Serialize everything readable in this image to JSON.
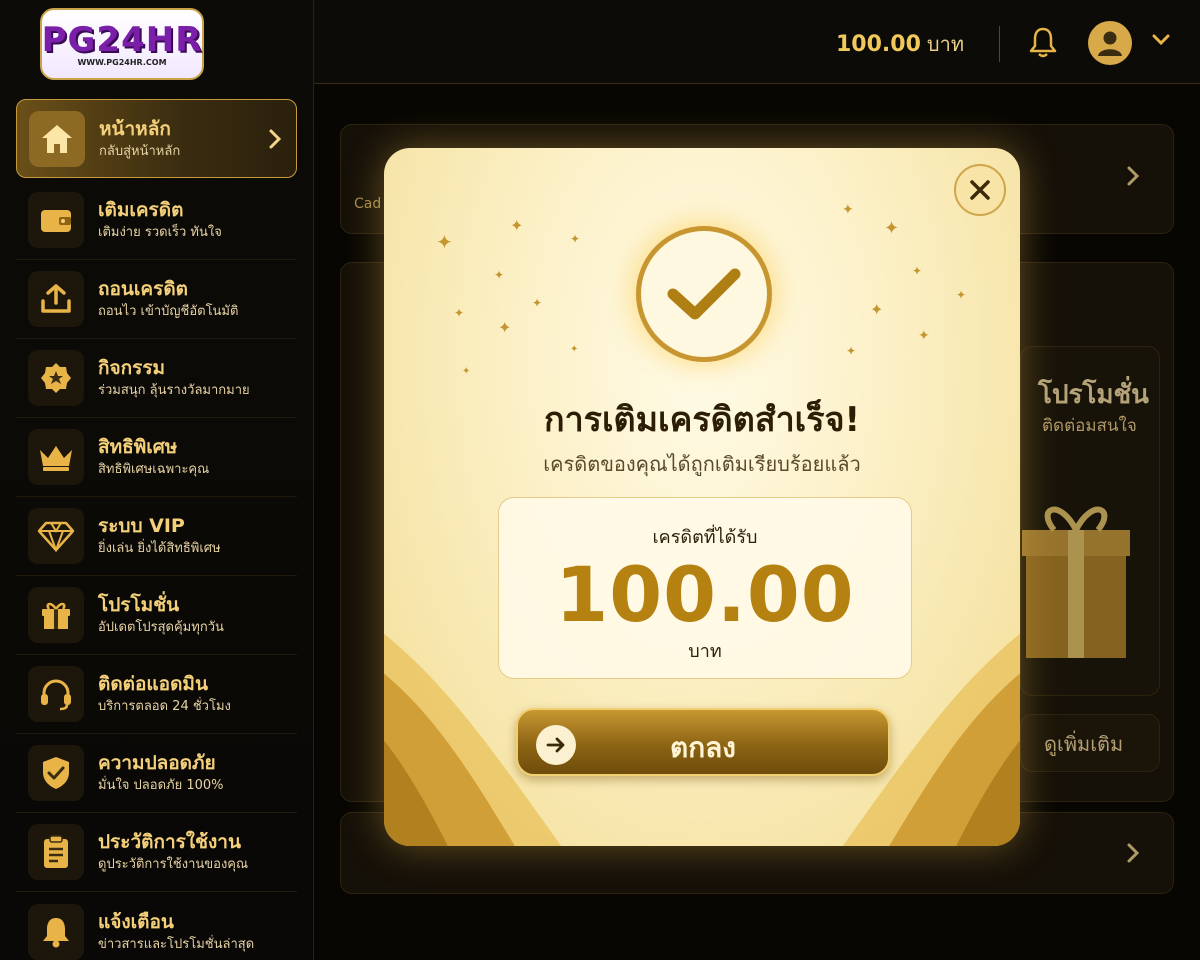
{
  "brand": {
    "logo_text": "PG24HR",
    "logo_url": "WWW.PG24HR.COM"
  },
  "header": {
    "balance_amount": "100.00",
    "balance_unit": "บาท",
    "bell_icon": "bell-icon",
    "avatar_icon": "user-icon"
  },
  "sidebar": {
    "items": [
      {
        "title": "หน้าหลัก",
        "sub": "กลับสู่หน้าหลัก",
        "icon": "home-icon",
        "active": true
      },
      {
        "title": "เติมเครดิต",
        "sub": "เติมง่าย รวดเร็ว ทันใจ",
        "icon": "wallet-icon"
      },
      {
        "title": "ถอนเครดิต",
        "sub": "ถอนไว เข้าบัญชีอัตโนมัติ",
        "icon": "upload-icon"
      },
      {
        "title": "กิจกรรม",
        "sub": "ร่วมสนุก ลุ้นรางวัลมากมาย",
        "icon": "star-badge-icon"
      },
      {
        "title": "สิทธิพิเศษ",
        "sub": "สิทธิพิเศษเฉพาะคุณ",
        "icon": "crown-icon"
      },
      {
        "title": "ระบบ VIP",
        "sub": "ยิ่งเล่น ยิ่งได้สิทธิพิเศษ",
        "icon": "diamond-icon"
      },
      {
        "title": "โปรโมชั่น",
        "sub": "อัปเดตโปรสุดคุ้มทุกวัน",
        "icon": "gift-icon"
      },
      {
        "title": "ติดต่อแอดมิน",
        "sub": "บริการตลอด 24 ชั่วโมง",
        "icon": "headset-icon"
      },
      {
        "title": "ความปลอดภัย",
        "sub": "มั่นใจ ปลอดภัย 100%",
        "icon": "shield-check-icon"
      },
      {
        "title": "ประวัติการใช้งาน",
        "sub": "ดูประวัติการใช้งานของคุณ",
        "icon": "clipboard-icon"
      },
      {
        "title": "แจ้งเตือน",
        "sub": "ข่าวสารและโปรโมชั่นล่าสุด",
        "icon": "bell-icon"
      }
    ]
  },
  "background": {
    "promo_title": "โปรโมชั่น",
    "promo_sub": "ติดต่อมสนใจ",
    "more_button": "ดูเพิ่มเติม",
    "partial_label": "Cad"
  },
  "modal": {
    "title": "การเติมเครดิตสำเร็จ!",
    "subtitle": "เครดิตของคุณได้ถูกเติมเรียบร้อยแล้ว",
    "credit_label": "เครดิตที่ได้รับ",
    "credit_amount": "100.00",
    "credit_unit": "บาท",
    "ok_button": "ตกลง",
    "close_icon": "close-icon",
    "check_icon": "check-icon"
  },
  "colors": {
    "accent": "#f0c85c",
    "dark": "#0b0905",
    "modal_bg": "#fbefc3",
    "amount": "#b58212"
  }
}
